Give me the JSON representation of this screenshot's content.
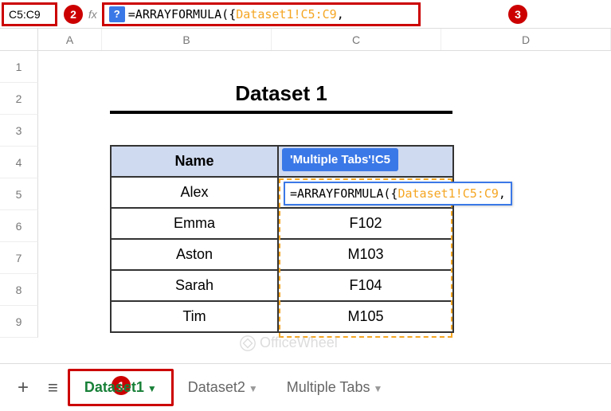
{
  "nameBox": "C5:C9",
  "formula": {
    "prefix": "=ARRAYFORMULA({",
    "ref": "Dataset1!C5:C9",
    "suffix": ","
  },
  "badges": {
    "b1": "1",
    "b2": "2",
    "b3": "3"
  },
  "columns": [
    "A",
    "B",
    "C",
    "D"
  ],
  "rows": [
    "1",
    "2",
    "3",
    "4",
    "5",
    "6",
    "7",
    "8",
    "9"
  ],
  "title": "Dataset 1",
  "headers": {
    "name": "Name",
    "tooltip": "'Multiple Tabs'!C5"
  },
  "tableRows": [
    {
      "name": "Alex",
      "id": ""
    },
    {
      "name": "Emma",
      "id": "F102"
    },
    {
      "name": "Aston",
      "id": "M103"
    },
    {
      "name": "Sarah",
      "id": "F104"
    },
    {
      "name": "Tim",
      "id": "M105"
    }
  ],
  "inlineFormula": {
    "prefix": "=ARRAYFORMULA({",
    "ref": "Dataset1!C5:C9",
    "suffix": ","
  },
  "tabs": {
    "t1": "Dataset1",
    "t2": "Dataset2",
    "t3": "Multiple Tabs"
  },
  "watermark": "OfficeWheel"
}
